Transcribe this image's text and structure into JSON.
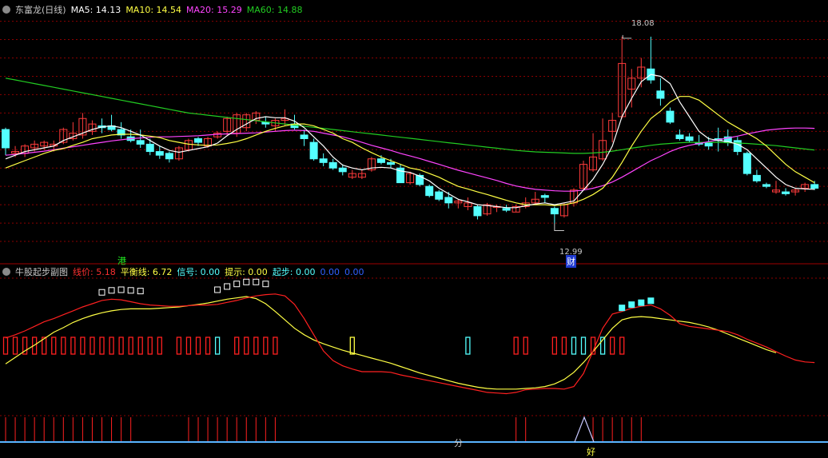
{
  "header_main": {
    "title": "东富龙(日线)",
    "ma5": "MA5: 14.13",
    "ma10": "MA10: 14.54",
    "ma20": "MA20: 15.29",
    "ma60": "MA60: 14.88"
  },
  "header_sub": {
    "title": "牛股起步副图",
    "line_price": "线价: 5.18",
    "balance": "平衡线: 6.72",
    "signal": "信号: 0.00",
    "hint": "提示: 0.00",
    "start": "起步: 0.00",
    "extra1": "0.00",
    "extra2": "0.00"
  },
  "annotations": {
    "high": "18.08",
    "low": "12.99",
    "mark_hk": "港",
    "mark_cai": "财",
    "mark_fen": "分",
    "mark_hao": "好"
  },
  "colors": {
    "up": "#ff3b3b",
    "down": "#54ffff",
    "ma5": "#ffffff",
    "ma10": "#ffff44",
    "ma20": "#ff44ff",
    "ma60": "#22cc22",
    "grid": "#8b0000",
    "baseline": "#5ab4ff"
  },
  "chart_data": [
    {
      "type": "candlestick",
      "title": "东富龙(日线)",
      "ylim": [
        12.0,
        18.6
      ],
      "y_ticks": [
        12.5,
        13.0,
        13.5,
        14.0,
        14.5,
        15.0,
        15.5,
        16.0,
        16.5,
        17.0,
        17.5,
        18.0,
        18.5
      ],
      "ohlc": [
        [
          15.55,
          15.6,
          14.85,
          15.05
        ],
        [
          14.9,
          15.1,
          14.8,
          14.95
        ],
        [
          14.9,
          15.15,
          14.8,
          15.1
        ],
        [
          15.05,
          15.25,
          14.95,
          15.15
        ],
        [
          15.1,
          15.25,
          15.0,
          15.2
        ],
        [
          15.1,
          15.25,
          14.95,
          15.15
        ],
        [
          15.2,
          15.6,
          15.15,
          15.55
        ],
        [
          15.3,
          15.75,
          15.25,
          15.45
        ],
        [
          15.4,
          16.0,
          15.3,
          15.85
        ],
        [
          15.5,
          15.8,
          15.4,
          15.7
        ],
        [
          15.65,
          15.85,
          15.45,
          15.6
        ],
        [
          15.65,
          15.95,
          15.5,
          15.55
        ],
        [
          15.55,
          15.75,
          15.3,
          15.4
        ],
        [
          15.35,
          15.55,
          15.2,
          15.25
        ],
        [
          15.25,
          15.55,
          15.05,
          15.15
        ],
        [
          15.15,
          15.3,
          14.85,
          14.95
        ],
        [
          14.95,
          15.1,
          14.75,
          14.85
        ],
        [
          14.9,
          14.95,
          14.65,
          14.75
        ],
        [
          14.75,
          15.1,
          14.7,
          15.05
        ],
        [
          15.0,
          15.3,
          14.95,
          15.25
        ],
        [
          15.3,
          15.35,
          15.1,
          15.2
        ],
        [
          15.1,
          15.35,
          15.05,
          15.3
        ],
        [
          15.35,
          15.5,
          15.3,
          15.45
        ],
        [
          15.5,
          15.9,
          15.4,
          15.85
        ],
        [
          15.45,
          16.0,
          15.35,
          15.95
        ],
        [
          15.6,
          16.0,
          15.5,
          15.95
        ],
        [
          15.8,
          16.05,
          15.7,
          16.0
        ],
        [
          15.75,
          15.9,
          15.6,
          15.7
        ],
        [
          15.65,
          15.85,
          15.5,
          15.8
        ],
        [
          15.8,
          16.1,
          15.65,
          15.85
        ],
        [
          15.7,
          15.95,
          15.55,
          15.6
        ],
        [
          15.4,
          15.55,
          15.1,
          15.3
        ],
        [
          15.2,
          15.3,
          14.7,
          14.75
        ],
        [
          14.75,
          14.9,
          14.55,
          14.65
        ],
        [
          14.65,
          14.75,
          14.45,
          14.5
        ],
        [
          14.5,
          14.6,
          14.3,
          14.4
        ],
        [
          14.25,
          14.45,
          14.2,
          14.35
        ],
        [
          14.25,
          14.45,
          14.2,
          14.35
        ],
        [
          14.45,
          14.8,
          14.4,
          14.75
        ],
        [
          14.75,
          14.85,
          14.6,
          14.65
        ],
        [
          14.65,
          14.75,
          14.5,
          14.6
        ],
        [
          14.5,
          14.6,
          14.1,
          14.1
        ],
        [
          14.1,
          14.4,
          14.05,
          14.35
        ],
        [
          14.3,
          14.35,
          14.0,
          14.05
        ],
        [
          14.0,
          14.05,
          13.7,
          13.75
        ],
        [
          13.85,
          13.9,
          13.6,
          13.65
        ],
        [
          13.7,
          13.85,
          13.4,
          13.55
        ],
        [
          13.55,
          13.65,
          13.4,
          13.6
        ],
        [
          13.45,
          13.7,
          13.35,
          13.55
        ],
        [
          13.45,
          13.5,
          13.1,
          13.2
        ],
        [
          13.25,
          13.55,
          13.2,
          13.5
        ],
        [
          13.45,
          13.5,
          13.3,
          13.45
        ],
        [
          13.4,
          13.5,
          13.3,
          13.35
        ],
        [
          13.3,
          13.5,
          13.3,
          13.45
        ],
        [
          13.45,
          13.7,
          13.4,
          13.55
        ],
        [
          13.55,
          13.85,
          13.5,
          13.65
        ],
        [
          13.75,
          13.8,
          13.55,
          13.7
        ],
        [
          13.4,
          13.45,
          12.99,
          13.25
        ],
        [
          13.2,
          13.55,
          13.15,
          13.5
        ],
        [
          13.55,
          13.95,
          13.45,
          13.9
        ],
        [
          13.95,
          14.7,
          13.9,
          14.6
        ],
        [
          14.45,
          15.45,
          14.4,
          14.8
        ],
        [
          14.75,
          15.85,
          14.7,
          15.25
        ],
        [
          15.5,
          16.0,
          15.2,
          15.8
        ],
        [
          15.9,
          18.08,
          15.85,
          17.35
        ],
        [
          16.65,
          17.2,
          16.15,
          16.95
        ],
        [
          16.95,
          17.5,
          16.7,
          17.25
        ],
        [
          17.2,
          18.08,
          16.8,
          16.9
        ],
        [
          16.6,
          16.95,
          16.2,
          16.4
        ],
        [
          16.05,
          16.15,
          15.7,
          15.75
        ],
        [
          15.4,
          15.55,
          15.25,
          15.3
        ],
        [
          15.35,
          15.45,
          15.2,
          15.25
        ],
        [
          15.2,
          15.4,
          15.1,
          15.15
        ],
        [
          15.2,
          15.35,
          15.0,
          15.1
        ],
        [
          15.3,
          15.6,
          14.95,
          15.25
        ],
        [
          15.35,
          15.55,
          15.1,
          15.2
        ],
        [
          15.25,
          15.35,
          14.85,
          14.95
        ],
        [
          14.9,
          14.95,
          14.3,
          14.35
        ],
        [
          14.3,
          14.45,
          14.1,
          14.15
        ],
        [
          14.05,
          14.1,
          13.95,
          14.0
        ],
        [
          13.85,
          14.15,
          13.8,
          13.9
        ],
        [
          13.85,
          13.95,
          13.75,
          13.8
        ],
        [
          13.85,
          13.95,
          13.75,
          13.9
        ],
        [
          13.95,
          14.1,
          13.85,
          14.05
        ],
        [
          14.05,
          14.15,
          13.9,
          13.95
        ]
      ],
      "ma5": [
        14.75,
        14.85,
        14.95,
        15.0,
        15.05,
        15.1,
        15.25,
        15.35,
        15.45,
        15.55,
        15.62,
        15.65,
        15.6,
        15.5,
        15.4,
        15.25,
        15.1,
        14.98,
        14.93,
        14.98,
        15.03,
        15.08,
        15.18,
        15.38,
        15.55,
        15.7,
        15.85,
        15.9,
        15.87,
        15.87,
        15.78,
        15.6,
        15.35,
        15.1,
        14.8,
        14.58,
        14.5,
        14.45,
        14.5,
        14.52,
        14.5,
        14.42,
        14.38,
        14.28,
        14.15,
        13.95,
        13.8,
        13.65,
        13.58,
        13.5,
        13.48,
        13.45,
        13.42,
        13.42,
        13.47,
        13.52,
        13.55,
        13.5,
        13.55,
        13.6,
        13.9,
        14.2,
        14.6,
        15.1,
        15.9,
        16.4,
        16.85,
        17.05,
        17.0,
        16.8,
        16.3,
        15.9,
        15.5,
        15.3,
        15.25,
        15.22,
        15.15,
        15.0,
        14.75,
        14.5,
        14.25,
        14.05,
        13.95,
        13.93,
        13.92
      ],
      "ma10": [
        14.5,
        14.6,
        14.7,
        14.8,
        14.9,
        14.98,
        15.03,
        15.12,
        15.2,
        15.3,
        15.35,
        15.4,
        15.42,
        15.42,
        15.4,
        15.37,
        15.33,
        15.25,
        15.2,
        15.15,
        15.13,
        15.12,
        15.13,
        15.17,
        15.22,
        15.3,
        15.4,
        15.5,
        15.58,
        15.65,
        15.7,
        15.7,
        15.65,
        15.55,
        15.45,
        15.3,
        15.2,
        15.05,
        14.92,
        14.8,
        14.7,
        14.6,
        14.5,
        14.45,
        14.35,
        14.25,
        14.12,
        14.0,
        13.93,
        13.85,
        13.78,
        13.7,
        13.62,
        13.55,
        13.5,
        13.5,
        13.5,
        13.48,
        13.5,
        13.55,
        13.65,
        13.78,
        13.95,
        14.25,
        14.65,
        15.1,
        15.5,
        15.85,
        16.05,
        16.3,
        16.45,
        16.45,
        16.35,
        16.15,
        15.95,
        15.75,
        15.6,
        15.45,
        15.3,
        15.1,
        14.85,
        14.6,
        14.4,
        14.25,
        14.1
      ],
      "ma20": [
        14.85,
        14.87,
        14.9,
        14.93,
        14.96,
        15.0,
        15.04,
        15.08,
        15.12,
        15.16,
        15.2,
        15.24,
        15.27,
        15.3,
        15.32,
        15.34,
        15.35,
        15.35,
        15.36,
        15.37,
        15.38,
        15.4,
        15.42,
        15.43,
        15.44,
        15.45,
        15.46,
        15.48,
        15.5,
        15.52,
        15.53,
        15.52,
        15.5,
        15.45,
        15.4,
        15.35,
        15.28,
        15.2,
        15.12,
        15.05,
        14.98,
        14.9,
        14.83,
        14.76,
        14.68,
        14.6,
        14.52,
        14.44,
        14.37,
        14.3,
        14.23,
        14.16,
        14.08,
        14.01,
        13.96,
        13.92,
        13.9,
        13.88,
        13.87,
        13.87,
        13.9,
        13.95,
        14.02,
        14.12,
        14.25,
        14.4,
        14.55,
        14.7,
        14.82,
        14.95,
        15.05,
        15.12,
        15.17,
        15.22,
        15.27,
        15.32,
        15.37,
        15.43,
        15.48,
        15.53,
        15.56,
        15.58,
        15.59,
        15.59,
        15.58
      ],
      "ma60": [
        16.95,
        16.9,
        16.85,
        16.8,
        16.75,
        16.7,
        16.65,
        16.6,
        16.55,
        16.5,
        16.45,
        16.4,
        16.35,
        16.3,
        16.25,
        16.2,
        16.15,
        16.1,
        16.05,
        16.0,
        15.97,
        15.94,
        15.91,
        15.88,
        15.85,
        15.82,
        15.79,
        15.76,
        15.73,
        15.7,
        15.67,
        15.64,
        15.61,
        15.58,
        15.55,
        15.52,
        15.49,
        15.46,
        15.43,
        15.4,
        15.37,
        15.34,
        15.31,
        15.28,
        15.25,
        15.22,
        15.19,
        15.16,
        15.13,
        15.1,
        15.07,
        15.04,
        15.01,
        14.98,
        14.96,
        14.94,
        14.93,
        14.92,
        14.91,
        14.9,
        14.9,
        14.91,
        14.93,
        14.96,
        15.0,
        15.04,
        15.08,
        15.12,
        15.15,
        15.17,
        15.19,
        15.2,
        15.2,
        15.2,
        15.2,
        15.19,
        15.18,
        15.17,
        15.15,
        15.13,
        15.11,
        15.08,
        15.05,
        15.02,
        14.99
      ]
    },
    {
      "type": "line",
      "title": "牛股起步副图",
      "series": [
        {
          "name": "线价",
          "values": [
            9.0,
            9.5,
            10.1,
            10.8,
            11.5,
            12.0,
            12.6,
            13.2,
            13.8,
            14.3,
            14.8,
            15.0,
            14.9,
            14.6,
            14.3,
            14.1,
            14.0,
            13.9,
            13.9,
            14.0,
            14.1,
            14.1,
            14.2,
            14.5,
            14.8,
            15.2,
            15.5,
            15.7,
            15.8,
            15.5,
            14.2,
            12.0,
            9.5,
            7.0,
            5.5,
            4.7,
            4.2,
            3.8,
            3.8,
            3.8,
            3.7,
            3.3,
            3.0,
            2.7,
            2.4,
            2.1,
            1.8,
            1.5,
            1.2,
            0.9,
            0.6,
            0.5,
            0.4,
            0.6,
            1.0,
            1.1,
            1.2,
            1.2,
            1.1,
            1.5,
            3.5,
            7.0,
            10.5,
            12.7,
            13.1,
            13.6,
            13.9,
            14.1,
            13.5,
            12.5,
            11.2,
            10.8,
            10.6,
            10.4,
            10.2,
            10.0,
            9.5,
            8.8,
            8.2,
            7.6,
            6.9,
            6.2,
            5.6,
            5.3,
            5.2
          ]
        },
        {
          "name": "平衡线",
          "values": [
            5.0,
            6.0,
            7.0,
            7.9,
            8.9,
            9.9,
            10.6,
            11.4,
            12.0,
            12.5,
            12.9,
            13.2,
            13.4,
            13.5,
            13.5,
            13.5,
            13.6,
            13.7,
            13.8,
            14.0,
            14.2,
            14.4,
            14.7,
            15.0,
            15.2,
            15.4,
            15.1,
            14.3,
            13.1,
            11.8,
            10.5,
            9.5,
            8.7,
            8.1,
            7.6,
            7.1,
            6.7,
            6.3,
            5.9,
            5.5,
            5.1,
            4.6,
            4.1,
            3.6,
            3.2,
            2.8,
            2.4,
            2.0,
            1.7,
            1.4,
            1.2,
            1.1,
            1.1,
            1.1,
            1.2,
            1.3,
            1.5,
            1.9,
            2.6,
            3.7,
            5.2,
            6.9,
            8.7,
            10.5,
            11.8,
            12.2,
            12.3,
            12.2,
            12.0,
            11.8,
            11.6,
            11.4,
            11.1,
            10.7,
            10.2,
            9.6,
            9.0,
            8.4,
            7.8,
            7.2,
            6.72
          ]
        }
      ],
      "square_markers": [
        [
          10,
          15.5
        ],
        [
          11,
          15.8
        ],
        [
          12,
          15.9
        ],
        [
          13,
          15.8
        ],
        [
          14,
          15.7
        ],
        [
          22,
          15.9
        ],
        [
          23,
          16.4
        ],
        [
          24,
          16.8
        ],
        [
          25,
          17.1
        ],
        [
          26,
          17.1
        ],
        [
          27,
          16.8
        ],
        [
          64,
          13.1
        ],
        [
          65,
          13.6
        ],
        [
          66,
          13.9
        ],
        [
          67,
          14.2
        ]
      ],
      "signal_bars": {
        "red": [
          0,
          1,
          2,
          3,
          4,
          5,
          6,
          7,
          8,
          9,
          10,
          11,
          12,
          13,
          14,
          15,
          16,
          18,
          19,
          20,
          21,
          24,
          25,
          26,
          27,
          28,
          53,
          54,
          57,
          58,
          61,
          63,
          64
        ],
        "yellow": [
          36
        ],
        "cyan": [
          22,
          48,
          59,
          60,
          62
        ]
      },
      "bottom_bars": [
        0,
        1,
        2,
        3,
        4,
        5,
        6,
        7,
        8,
        9,
        10,
        11,
        12,
        13,
        19,
        20,
        21,
        22,
        23,
        24,
        25,
        26,
        27,
        28,
        53,
        54,
        61,
        62,
        63,
        64,
        65,
        66
      ],
      "ylim": [
        -3,
        18
      ]
    }
  ]
}
